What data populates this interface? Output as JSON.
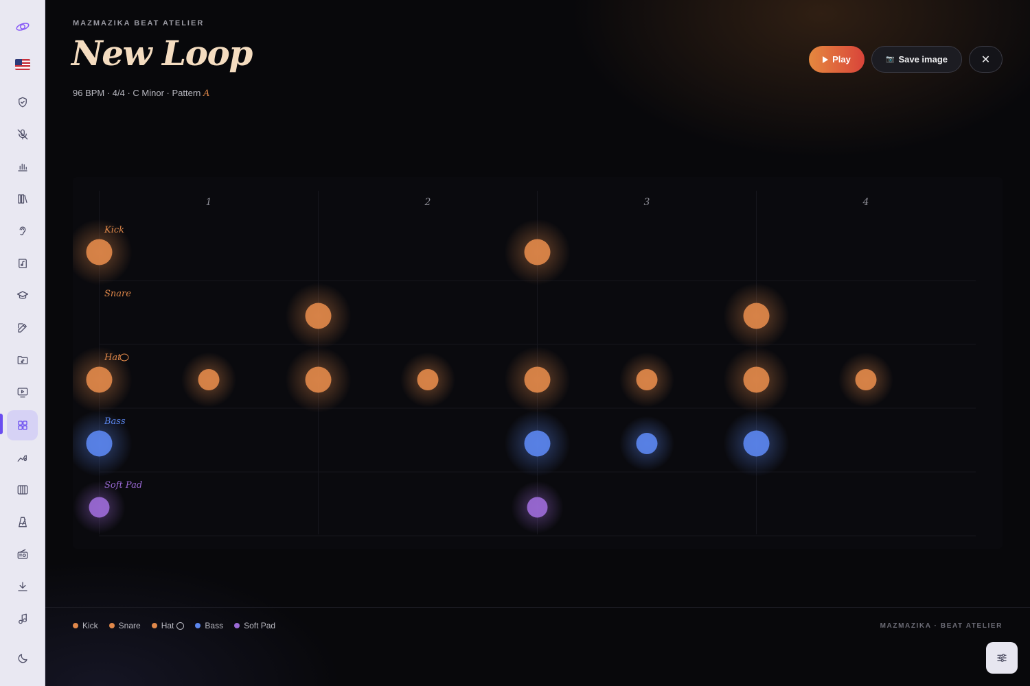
{
  "app": {
    "brand": "MAZMAZIKA BEAT ATELIER",
    "title": "New Loop",
    "subtitle": "96 BPM · 4/4 · C Minor · Pattern ",
    "pattern": "A",
    "footer_brand": "MAZMAZIKA · BEAT ATELIER"
  },
  "toolbar": {
    "play_label": "Play",
    "save_label": "Save image",
    "close_symbol": "✕"
  },
  "sidebar": {
    "active_item": "grid",
    "items": [
      {
        "icon": "saturn-logo-icon"
      },
      {
        "icon": "us-flag-icon"
      },
      {
        "icon": "shield-check-icon"
      },
      {
        "icon": "mic-off-icon"
      },
      {
        "icon": "bar-chart-icon"
      },
      {
        "icon": "library-icon"
      },
      {
        "icon": "ear-icon"
      },
      {
        "icon": "book-music-icon"
      },
      {
        "icon": "graduation-cap-icon"
      },
      {
        "icon": "edit-icon"
      },
      {
        "icon": "folder-music-icon"
      },
      {
        "icon": "monitor-play-icon"
      },
      {
        "icon": "grid-icon"
      },
      {
        "icon": "melody-icon"
      },
      {
        "icon": "piano-icon"
      },
      {
        "icon": "metronome-icon"
      },
      {
        "icon": "radio-icon"
      },
      {
        "icon": "download-icon"
      },
      {
        "icon": "music-note-icon"
      },
      {
        "icon": "moon-icon"
      }
    ]
  },
  "sequencer": {
    "beats": [
      "1",
      "2",
      "3",
      "4"
    ],
    "steps": 16,
    "tracks": [
      {
        "name": "Kick",
        "color": "#e0884a",
        "hits": [
          0,
          8
        ]
      },
      {
        "name": "Snare",
        "color": "#e0884a",
        "hits": [
          4,
          12
        ]
      },
      {
        "name": "Hat",
        "color": "#e0884a",
        "hits": [
          0,
          2,
          4,
          6,
          8,
          10,
          12,
          14
        ]
      },
      {
        "name": "Bass",
        "color": "#5b86ee",
        "hits": [
          0,
          8,
          10,
          12
        ]
      },
      {
        "name": "Soft Pad",
        "color": "#9b6ad6",
        "hits": [
          0,
          8
        ]
      }
    ]
  },
  "legend": [
    {
      "label": "Kick",
      "color": "#e0884a"
    },
    {
      "label": "Snare",
      "color": "#e0884a"
    },
    {
      "label": "Hat",
      "color": "#e0884a"
    },
    {
      "label": "Bass",
      "color": "#5b86ee"
    },
    {
      "label": "Soft Pad",
      "color": "#9b6ad6"
    }
  ]
}
